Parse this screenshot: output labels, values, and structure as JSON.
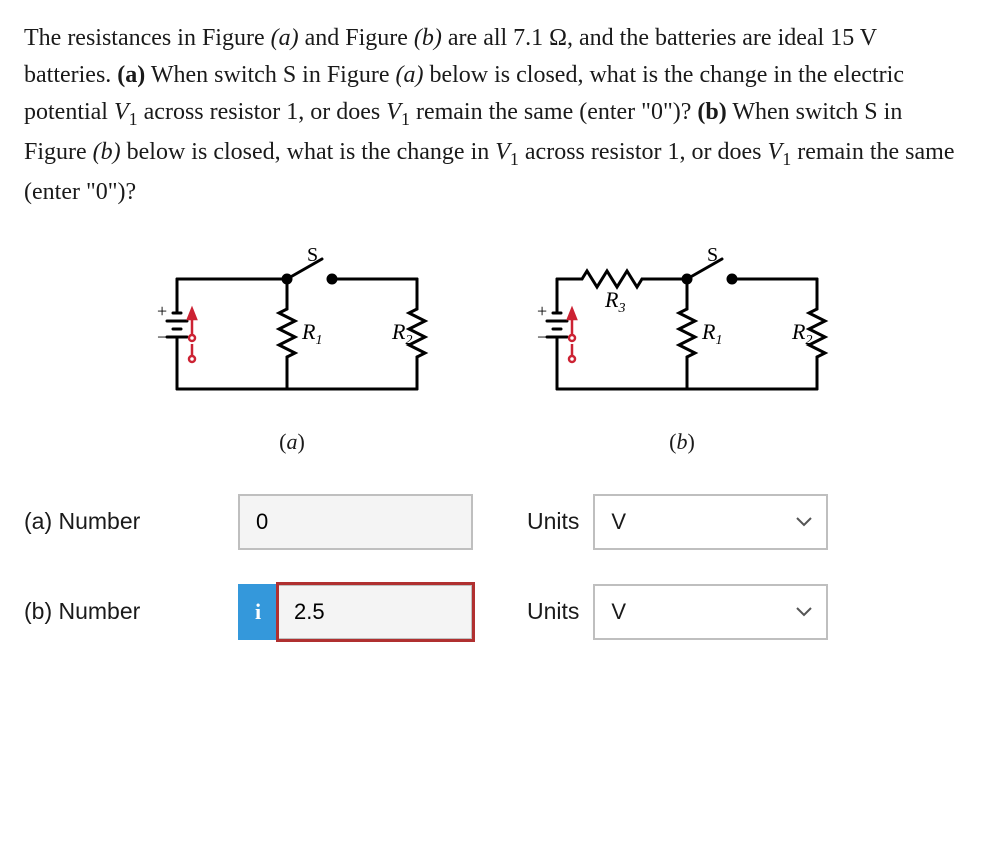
{
  "question": {
    "intro_a": "The resistances in Figure ",
    "fa": "(a)",
    "intro_b": " and Figure ",
    "fb": "(b)",
    "intro_c": " are all 7.1 Ω, and the batteries are ideal 15 V batteries. ",
    "pa": "(a)",
    "pa_text_1": " When switch S in Figure ",
    "pa_text_2": " below is closed, what is the change in the electric potential ",
    "v1_a": "V",
    "v1_sub": "1",
    "pa_text_3": " across resistor 1, or does ",
    "pa_text_4": " remain the same (enter \"0\")? ",
    "pb": "(b)",
    "pb_text_1": " When switch S in Figure ",
    "pb_text_2": " below is closed, what is the change in ",
    "pb_text_3": " across resistor 1, or does ",
    "pb_text_4": " remain the same (enter \"0\")?"
  },
  "circuit": {
    "S": "S",
    "R1": "R",
    "R1_sub": "1",
    "R2": "R",
    "R2_sub": "2",
    "R3": "R",
    "R3_sub": "3",
    "plus": "+",
    "minus": "−",
    "label_a": "(a)",
    "label_b": "(b)"
  },
  "answers": {
    "a": {
      "label": "(a)   Number",
      "value": "0",
      "units_label": "Units",
      "units_value": "V"
    },
    "b": {
      "label": "(b)   Number",
      "value": "2.5",
      "units_label": "Units",
      "units_value": "V",
      "i_badge": "i"
    }
  }
}
